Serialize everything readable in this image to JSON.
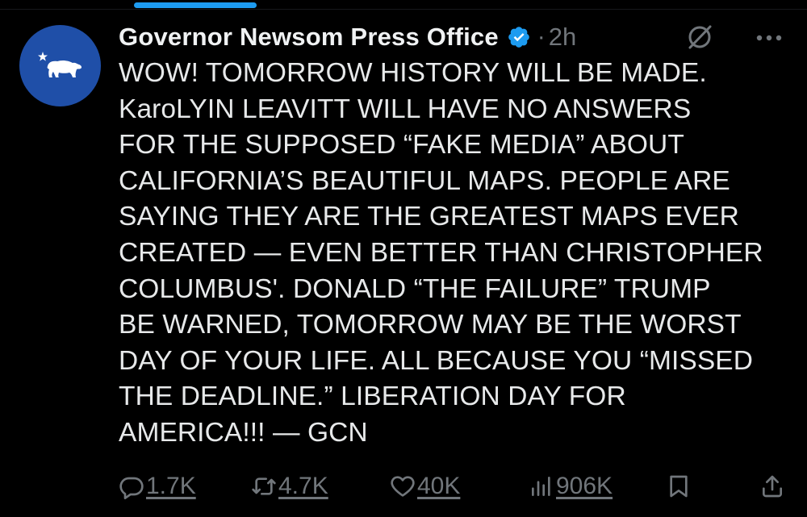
{
  "post": {
    "author_name": "Governor Newsom Press Office",
    "separator": "·",
    "timestamp": "2h",
    "text": "WOW! TOMORROW HISTORY WILL BE MADE.\nKaroLYIN LEAVITT WILL HAVE NO ANSWERS\nFOR THE SUPPOSED “FAKE MEDIA” ABOUT\nCALIFORNIA’S BEAUTIFUL MAPS. PEOPLE ARE\nSAYING THEY ARE THE GREATEST MAPS EVER\nCREATED — EVEN BETTER THAN CHRISTOPHER\nCOLUMBUS'. DONALD “THE FAILURE” TRUMP\nBE WARNED, TOMORROW MAY BE THE WORST\nDAY OF YOUR LIFE. ALL BECAUSE YOU “MISSED\nTHE DEADLINE.”  LIBERATION DAY FOR\nAMERICA!!! — GCN"
  },
  "actions": {
    "replies": "1.7K",
    "reposts": "4.7K",
    "likes": "40K",
    "views": "906K"
  },
  "icons": [
    "verified-badge-icon",
    "grok-icon",
    "more-icon",
    "reply-icon",
    "repost-icon",
    "like-icon",
    "views-icon",
    "bookmark-icon",
    "share-icon"
  ],
  "colors": {
    "background": "#000000",
    "text": "#e7e9ea",
    "secondary": "#71767b",
    "accent": "#1d9bf0",
    "avatar": "#1f4fa8"
  }
}
